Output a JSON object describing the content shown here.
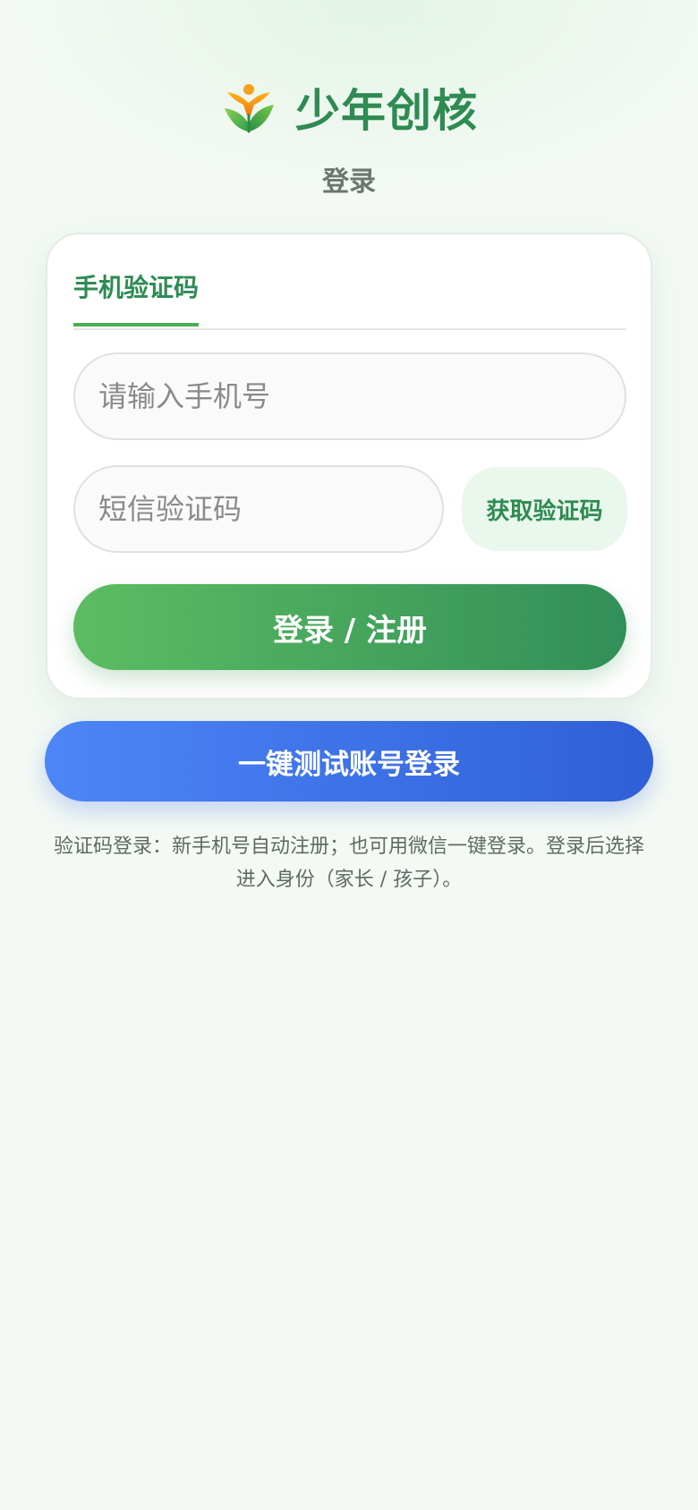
{
  "header": {
    "app_name": "少年创核",
    "logo_icon": "sprout-person-icon",
    "brand_color": "#2e8b52"
  },
  "page_title": "登录",
  "tabs": [
    {
      "label": "手机验证码",
      "active": true
    }
  ],
  "form": {
    "phone_placeholder": "请输入手机号",
    "phone_value": "",
    "code_placeholder": "短信验证码",
    "code_value": "",
    "get_code_label": "获取验证码",
    "submit_label": "登录 / 注册"
  },
  "test_login_label": "一键测试账号登录",
  "hint": "验证码登录：新手机号自动注册；也可用微信一键登录。登录后选择进入身份（家长 / 孩子）。",
  "colors": {
    "accent_green": "#4caf50",
    "test_button_blue": "#3b6fe8",
    "background": "#f4f9f4"
  }
}
